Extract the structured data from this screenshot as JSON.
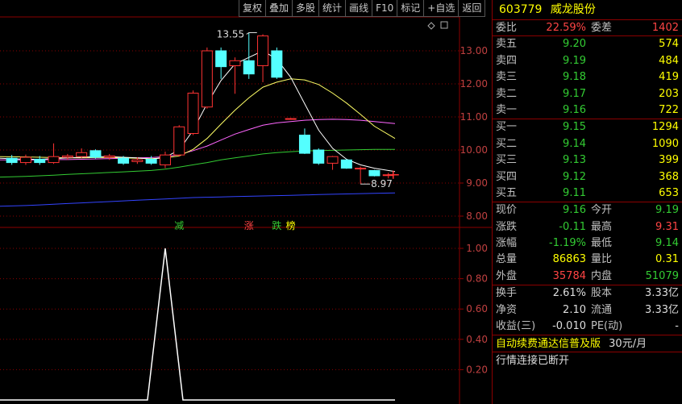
{
  "toolbar": [
    {
      "id": "fuquan",
      "label": "复权"
    },
    {
      "id": "diejia",
      "label": "叠加"
    },
    {
      "id": "duogu",
      "label": "多股"
    },
    {
      "id": "tongji",
      "label": "统计"
    },
    {
      "id": "huaxian",
      "label": "画线"
    },
    {
      "id": "f10",
      "label": "F10"
    },
    {
      "id": "biaoji",
      "label": "标记"
    },
    {
      "id": "zixuan",
      "label": "+自选"
    },
    {
      "id": "fanhui",
      "label": "返回"
    }
  ],
  "stock": {
    "code": "603779",
    "name": "威龙股份"
  },
  "weibi": {
    "label": "委比",
    "value": "22.59%",
    "label2": "委差",
    "value2": "1402"
  },
  "sell": [
    {
      "label": "卖五",
      "price": "9.20",
      "vol": "574"
    },
    {
      "label": "卖四",
      "price": "9.19",
      "vol": "484"
    },
    {
      "label": "卖三",
      "price": "9.18",
      "vol": "419"
    },
    {
      "label": "卖二",
      "price": "9.17",
      "vol": "203"
    },
    {
      "label": "卖一",
      "price": "9.16",
      "vol": "722"
    }
  ],
  "buy": [
    {
      "label": "买一",
      "price": "9.15",
      "vol": "1294"
    },
    {
      "label": "买二",
      "price": "9.14",
      "vol": "1090"
    },
    {
      "label": "买三",
      "price": "9.13",
      "vol": "399"
    },
    {
      "label": "买四",
      "price": "9.12",
      "vol": "368"
    },
    {
      "label": "买五",
      "price": "9.11",
      "vol": "653"
    }
  ],
  "quote": {
    "xianjia": {
      "label": "现价",
      "value": "9.16"
    },
    "jinkai": {
      "label": "今开",
      "value": "9.19"
    },
    "zhangdie": {
      "label": "涨跌",
      "value": "-0.11"
    },
    "zuigao": {
      "label": "最高",
      "value": "9.31"
    },
    "zhangfu": {
      "label": "涨幅",
      "value": "-1.19%"
    },
    "zuidi": {
      "label": "最低",
      "value": "9.14"
    },
    "zongliang": {
      "label": "总量",
      "value": "86863"
    },
    "liangbi": {
      "label": "量比",
      "value": "0.31"
    },
    "waipan": {
      "label": "外盘",
      "value": "35784"
    },
    "neipan": {
      "label": "内盘",
      "value": "51079"
    }
  },
  "fundamentals": {
    "huanshou": {
      "label": "换手",
      "value": "2.61%"
    },
    "guben": {
      "label": "股本",
      "value": "3.33亿"
    },
    "jingzi": {
      "label": "净资",
      "value": "2.10"
    },
    "liutong": {
      "label": "流通",
      "value": "3.33亿"
    },
    "shouyi": {
      "label": "收益(三)",
      "value": "-0.010"
    },
    "pe": {
      "label": "PE(动)",
      "value": "-"
    }
  },
  "promo": {
    "text": "自动续费通达信普及版",
    "price": "30元/月"
  },
  "status": {
    "text": "行情连接已断开"
  },
  "colors": {
    "up": "#ff3333",
    "down": "#54ffff",
    "ma5": "#ffffff",
    "ma10": "#ffff66",
    "ma20": "#ff66ff",
    "ma60": "#33cc33",
    "ma120": "#3344ff",
    "indicator": "#ffffff",
    "grid": "#8b0000"
  },
  "chart_data": [
    {
      "type": "candlestick",
      "ylim": [
        7.9,
        13.7
      ],
      "yticks": [
        "13.00",
        "12.00",
        "11.00",
        "10.00",
        "9.00",
        "8.00"
      ],
      "annotations": {
        "high": "13.55",
        "low": "8.97"
      },
      "signals": [
        {
          "label": "减",
          "color": "#33cc33"
        },
        {
          "label": "涨",
          "color": "#ff4444"
        },
        {
          "label": "跌",
          "color": "#33cc33"
        },
        {
          "label": "榜",
          "color": "#ffff00"
        }
      ],
      "candles": [
        {
          "o": 9.75,
          "c": 9.62,
          "h": 9.85,
          "l": 9.55
        },
        {
          "o": 9.62,
          "c": 9.78,
          "h": 9.86,
          "l": 9.55
        },
        {
          "o": 9.72,
          "c": 9.62,
          "h": 9.82,
          "l": 9.55
        },
        {
          "o": 9.62,
          "c": 9.8,
          "h": 10.2,
          "l": 9.58
        },
        {
          "o": 9.78,
          "c": 9.82,
          "h": 9.88,
          "l": 9.7
        },
        {
          "o": 9.8,
          "c": 9.92,
          "h": 10.05,
          "l": 9.75
        },
        {
          "o": 9.98,
          "c": 9.78,
          "h": 10.02,
          "l": 9.74
        },
        {
          "o": 9.78,
          "c": 9.82,
          "h": 9.88,
          "l": 9.7
        },
        {
          "o": 9.75,
          "c": 9.6,
          "h": 9.82,
          "l": 9.55
        },
        {
          "o": 9.65,
          "c": 9.7,
          "h": 9.78,
          "l": 9.58
        },
        {
          "o": 9.72,
          "c": 9.6,
          "h": 9.82,
          "l": 9.55
        },
        {
          "o": 9.55,
          "c": 9.85,
          "h": 9.95,
          "l": 9.45
        },
        {
          "o": 9.85,
          "c": 10.7,
          "h": 10.75,
          "l": 9.8
        },
        {
          "o": 10.5,
          "c": 11.72,
          "h": 11.8,
          "l": 10.45
        },
        {
          "o": 11.3,
          "c": 13.0,
          "h": 13.1,
          "l": 11.25
        },
        {
          "o": 13.0,
          "c": 12.52,
          "h": 13.1,
          "l": 12.15
        },
        {
          "o": 12.55,
          "c": 12.7,
          "h": 12.8,
          "l": 11.7
        },
        {
          "o": 12.7,
          "c": 12.3,
          "h": 13.55,
          "l": 12.15
        },
        {
          "o": 12.55,
          "c": 13.45,
          "h": 13.5,
          "l": 12.05
        },
        {
          "o": 13.0,
          "c": 12.2,
          "h": 13.1,
          "l": 12.15
        },
        {
          "o": 10.95,
          "c": 10.95,
          "h": 10.97,
          "l": 10.93
        },
        {
          "o": 10.45,
          "c": 9.9,
          "h": 10.65,
          "l": 9.88
        },
        {
          "o": 10.0,
          "c": 9.6,
          "h": 10.05,
          "l": 9.55
        },
        {
          "o": 9.6,
          "c": 9.8,
          "h": 9.82,
          "l": 9.4
        },
        {
          "o": 9.7,
          "c": 9.45,
          "h": 9.72,
          "l": 9.43
        },
        {
          "o": 9.45,
          "c": 9.45,
          "h": 9.5,
          "l": 8.97
        },
        {
          "o": 9.38,
          "c": 9.22,
          "h": 9.4,
          "l": 9.2
        },
        {
          "o": 9.25,
          "c": 9.25,
          "h": 9.31,
          "l": 9.14
        }
      ],
      "series": [
        {
          "id": "ma5",
          "values": [
            9.75,
            9.72,
            9.72,
            9.74,
            9.76,
            9.78,
            9.8,
            9.8,
            9.78,
            9.76,
            9.72,
            9.78,
            10.0,
            10.6,
            11.4,
            12.1,
            12.6,
            12.8,
            13.0,
            12.75,
            12.2,
            11.4,
            10.6,
            10.05,
            9.72,
            9.55,
            9.45,
            9.35
          ]
        },
        {
          "id": "ma10",
          "values": [
            9.8,
            9.79,
            9.78,
            9.77,
            9.76,
            9.76,
            9.77,
            9.77,
            9.76,
            9.75,
            9.74,
            9.76,
            9.82,
            10.02,
            10.35,
            10.78,
            11.2,
            11.58,
            11.9,
            12.05,
            12.15,
            12.12,
            11.98,
            11.72,
            11.42,
            11.08,
            10.72,
            10.35
          ]
        },
        {
          "id": "ma20",
          "values": [
            9.7,
            9.7,
            9.7,
            9.71,
            9.71,
            9.72,
            9.73,
            9.74,
            9.75,
            9.76,
            9.77,
            9.8,
            9.86,
            9.98,
            10.12,
            10.3,
            10.48,
            10.62,
            10.75,
            10.82,
            10.86,
            10.9,
            10.92,
            10.93,
            10.92,
            10.9,
            10.86,
            10.8
          ]
        },
        {
          "id": "ma60",
          "values": [
            9.18,
            9.2,
            9.22,
            9.24,
            9.26,
            9.28,
            9.3,
            9.32,
            9.34,
            9.36,
            9.38,
            9.42,
            9.48,
            9.55,
            9.62,
            9.7,
            9.76,
            9.82,
            9.88,
            9.92,
            9.95,
            9.97,
            9.98,
            9.99,
            10.0,
            10.01,
            10.02,
            10.02
          ]
        },
        {
          "id": "ma120",
          "values": [
            8.3,
            8.32,
            8.34,
            8.36,
            8.38,
            8.4,
            8.42,
            8.44,
            8.46,
            8.48,
            8.5,
            8.52,
            8.54,
            8.56,
            8.57,
            8.58,
            8.59,
            8.6,
            8.61,
            8.62,
            8.63,
            8.64,
            8.65,
            8.66,
            8.67,
            8.68,
            8.69,
            8.7
          ]
        }
      ]
    },
    {
      "type": "line",
      "ylim": [
        0,
        1.04
      ],
      "yticks": [
        "1.00",
        "0.80",
        "0.60",
        "0.40",
        "0.20"
      ],
      "series": [
        {
          "id": "indicator",
          "values": [
            0,
            0,
            0,
            0,
            0,
            0,
            0,
            0,
            0,
            0,
            0,
            1,
            0,
            0,
            0,
            0,
            0,
            0,
            0,
            0,
            0,
            0,
            0,
            0,
            0,
            0,
            0,
            0
          ]
        }
      ]
    }
  ]
}
